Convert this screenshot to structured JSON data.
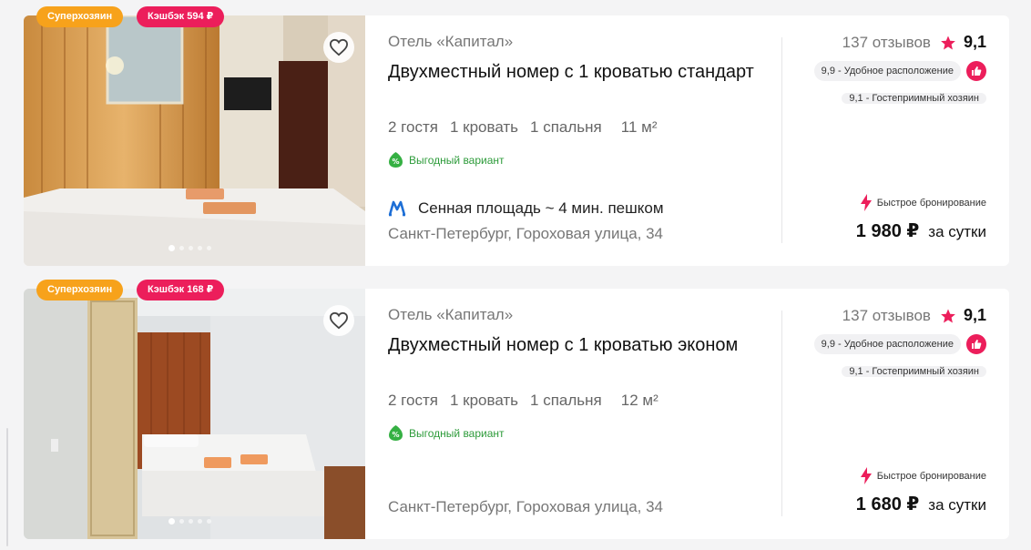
{
  "cards": [
    {
      "badge_superhost": "Суперхозяин",
      "badge_cashback": "Кэшбэк 594 ₽",
      "hotel": "Отель «Капитал»",
      "title": "Двухместный номер с 1 кроватью стандарт",
      "guests": "2 гостя",
      "beds": "1 кровать",
      "bedrooms": "1 спальня",
      "area": "11 м²",
      "deal": "Выгодный вариант",
      "metro": "Сенная площадь ~ 4 мин. пешком",
      "address": "Санкт-Петербург, Гороховая улица, 34",
      "reviews": "137 отзывов",
      "score": "9,1",
      "tag_location": "9,9 - Удобное расположение",
      "tag_host": "9,1 - Гостеприимный хозяин",
      "fast_booking": "Быстрое бронирование",
      "price": "1 980 ₽",
      "per": "за сутки",
      "photo_index": 1,
      "photo_count": 5
    },
    {
      "badge_superhost": "Суперхозяин",
      "badge_cashback": "Кэшбэк 168 ₽",
      "hotel": "Отель «Капитал»",
      "title": "Двухместный номер с 1 кроватью эконом",
      "guests": "2 гостя",
      "beds": "1 кровать",
      "bedrooms": "1 спальня",
      "area": "12 м²",
      "deal": "Выгодный вариант",
      "metro": "",
      "address": "Санкт-Петербург, Гороховая улица, 34",
      "reviews": "137 отзывов",
      "score": "9,1",
      "tag_location": "9,9 - Удобное расположение",
      "tag_host": "9,1 - Гостеприимный хозяин",
      "fast_booking": "Быстрое бронирование",
      "price": "1 680 ₽",
      "per": "за сутки",
      "photo_index": 1,
      "photo_count": 5
    }
  ],
  "colors": {
    "superhost": "#f7a21b",
    "cashback": "#ec1e5b",
    "deal_green": "#2d9b3a",
    "metro_blue": "#1e6fd6",
    "accent": "#ec1e5b"
  },
  "icons": {
    "favorite": "heart-outline-icon",
    "rating": "star-icon",
    "like": "thumbs-up-icon",
    "deal": "leaf-percent-icon",
    "metro": "metro-m-icon",
    "fast": "lightning-icon"
  }
}
